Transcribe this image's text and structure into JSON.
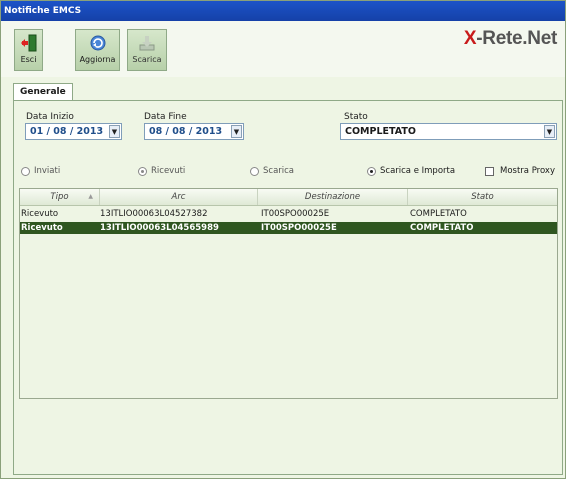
{
  "window": {
    "title": "Notifiche EMCS"
  },
  "toolbar": {
    "exit_label": "Esci",
    "refresh_label": "Aggiorna",
    "download_label": "Scarica"
  },
  "logo": {
    "x": "X",
    "rest": "-Rete.Net"
  },
  "tabs": [
    {
      "label": "Generale"
    }
  ],
  "filters": {
    "data_inizio_label": "Data Inizio",
    "data_inizio_value": "01 / 08 / 2013",
    "data_fine_label": "Data Fine",
    "data_fine_value": "08 / 08 / 2013",
    "stato_label": "Stato",
    "stato_value": "COMPLETATO"
  },
  "options": {
    "inviati": "Inviati",
    "ricevuti": "Ricevuti",
    "scarica": "Scarica",
    "scarica_importa": "Scarica e Importa",
    "mostra_proxy": "Mostra Proxy",
    "selected": "scarica_importa"
  },
  "grid": {
    "columns": [
      "Tipo",
      "Arc",
      "Destinazione",
      "Stato"
    ],
    "rows": [
      {
        "tipo": "Ricevuto",
        "arc": "13ITLIO00063L04527382",
        "destinazione": "IT00SPO00025E",
        "stato": "COMPLETATO",
        "selected": false
      },
      {
        "tipo": "Ricevuto",
        "arc": "13ITLIO00063L04565989",
        "destinazione": "IT00SPO00025E",
        "stato": "COMPLETATO",
        "selected": true
      }
    ]
  },
  "colors": {
    "title_bar": "#1c53c8",
    "selected_row": "#2f5620",
    "logo_accent": "#c81b1b"
  }
}
